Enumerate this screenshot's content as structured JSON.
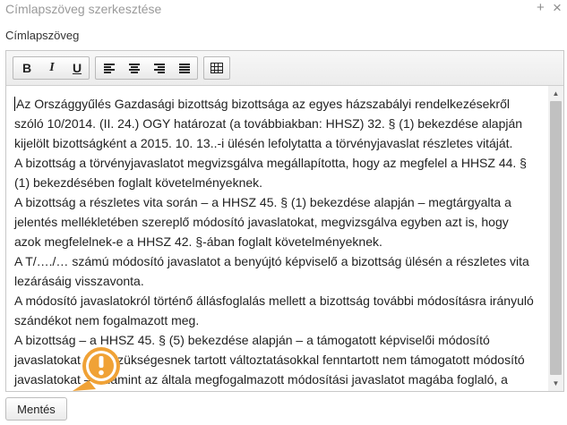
{
  "dialog": {
    "title": "Címlapszöveg szerkesztése",
    "add_label": "+",
    "close_label": "×"
  },
  "field": {
    "label": "Címlapszöveg"
  },
  "toolbar": {
    "bold_label": "B",
    "italic_label": "I",
    "underline_label": "U"
  },
  "editor": {
    "paragraphs": [
      "Az Országgyűlés Gazdasági bizottság bizottsága az egyes házszabályi rendelkezésekről szóló 10/2014. (II. 24.) OGY határozat (a továbbiakban: HHSZ) 32. § (1) bekezdése alapján kijelölt bizottságként a 2015. 10. 13..-i ülésén lefolytatta a törvényjavaslat részletes vitáját.",
      "A bizottság a törvényjavaslatot megvizsgálva megállapította, hogy az megfelel a HHSZ 44. § (1) bekezdésében foglalt követelményeknek.",
      "A bizottság a részletes vita során – a HHSZ 45. § (1) bekezdése alapján – megtárgyalta a jelentés mellékletében szereplő módosító javaslatokat, megvizsgálva egyben azt is, hogy azok megfelelnek-e a HHSZ 42. §-ában foglalt követelményeknek.",
      "A T/…./… számú módosító javaslatot a benyújtó képviselő a bizottság ülésén a részletes vita lezárásáig visszavonta.",
      "A módosító javaslatokról történő állásfoglalás mellett a bizottság további módosításra irányuló szándékot nem fogalmazott meg.",
      "A bizottság – a HHSZ 45. § (5) bekezdése alapján – a támogatott képviselői módosító javaslatokat és a szükségesnek tartott változtatásokkal fenntartott nem támogatott módosító javaslatokat – valamint az általa megfogalmazott módosítási javaslatot magába foglaló, a"
    ]
  },
  "footer": {
    "save_label": "Mentés"
  },
  "colors": {
    "warning_badge": "#f0a236",
    "scroll_thumb": "#c1c1c1"
  }
}
